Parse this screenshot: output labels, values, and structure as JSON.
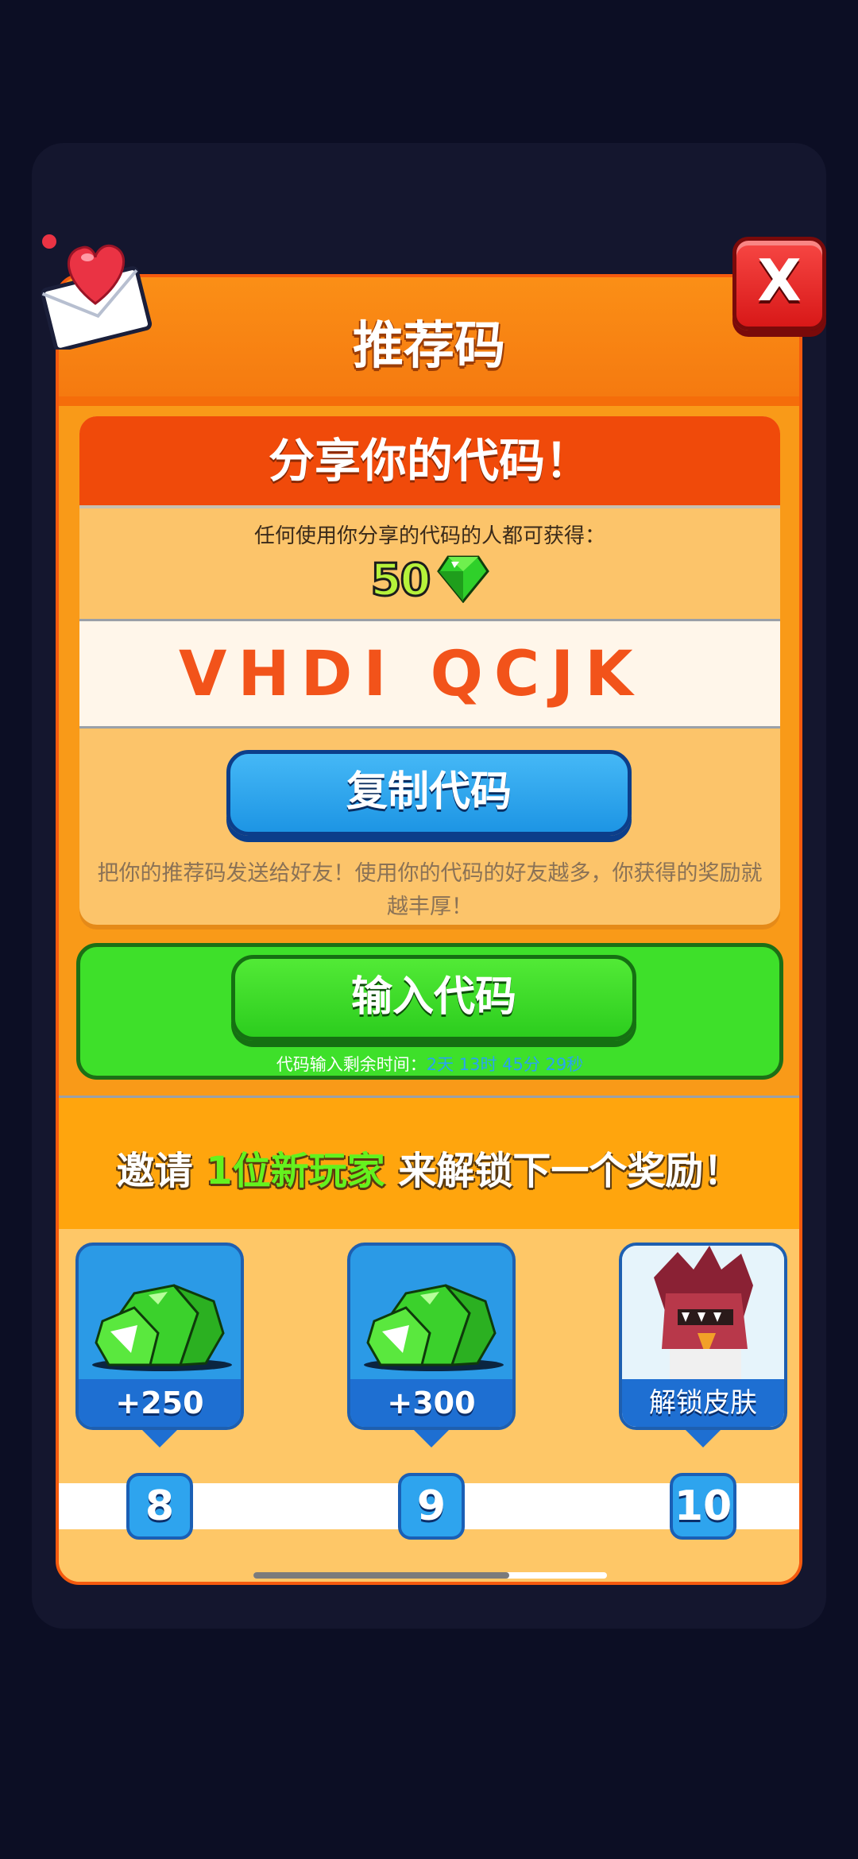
{
  "title": "推荐码",
  "share": {
    "heading": "分享你的代码！",
    "anyone_text": "任何使用你分享的代码的人都可获得：",
    "reward_amount": "50",
    "reward_icon": "gem-icon",
    "code": "VHDI QCJK",
    "copy_button": "复制代码",
    "note": "把你的推荐码发送给好友！使用你的代码的好友越多，你获得的奖励就越丰厚！"
  },
  "enter": {
    "button": "输入代码",
    "timer_label": "代码输入剩余时间：",
    "timer_value": "2天 13时 45分 29秒"
  },
  "invite": {
    "prefix": "邀请 ",
    "highlight": "1位新玩家",
    "suffix": " 来解锁下一个奖励！"
  },
  "rewards": [
    {
      "label": "+250",
      "icon": "gem-pile-icon",
      "level": "8"
    },
    {
      "label": "+300",
      "icon": "gem-pile-icon",
      "level": "9"
    },
    {
      "label": "解锁皮肤",
      "icon": "skin-character-icon",
      "level": "10"
    }
  ],
  "close_button": "X",
  "colors": {
    "header_orange": "#fb8f16",
    "share_red": "#f04a0a",
    "code_orange": "#f2531a",
    "copy_blue": "#2ba6ef",
    "enter_green": "#3ee02a",
    "invite_highlight": "#64f21e",
    "close_red": "#e02a28"
  }
}
